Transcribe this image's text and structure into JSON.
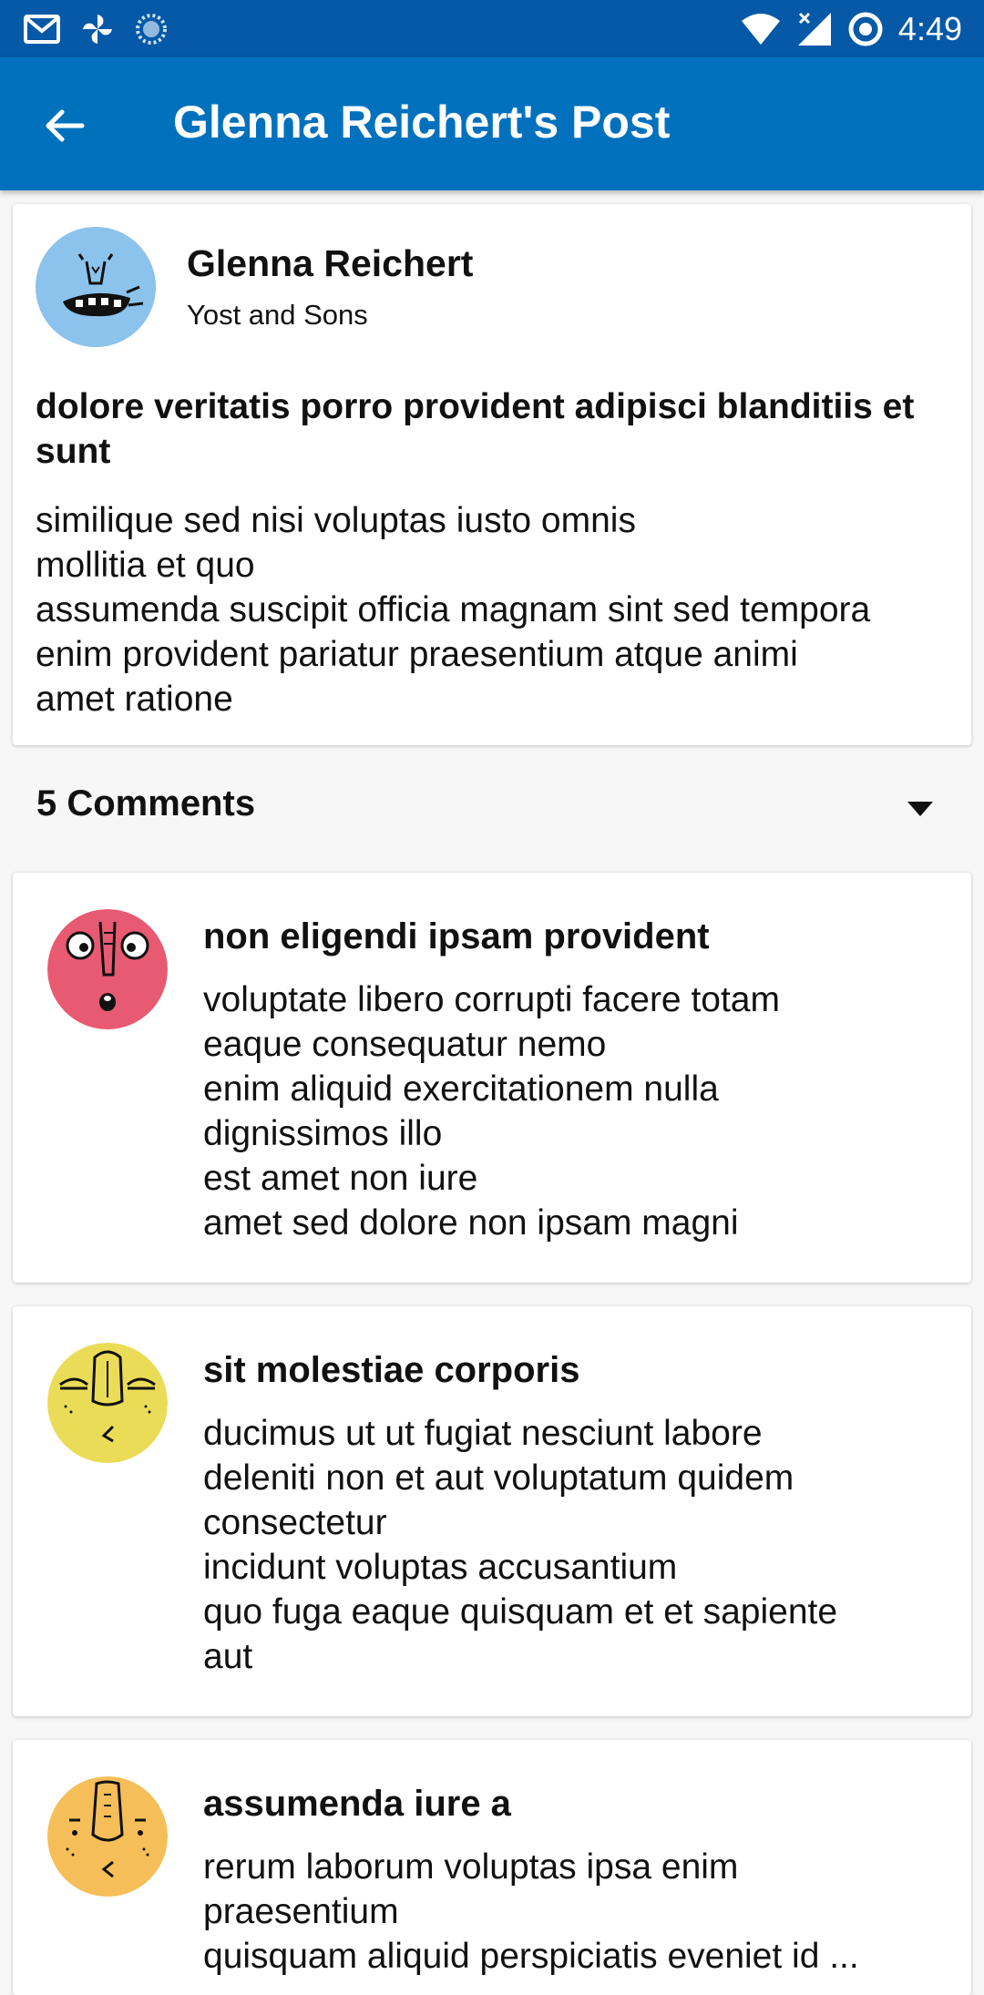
{
  "status_bar": {
    "time": "4:49",
    "left_icons": [
      "mail-icon",
      "pinwheel-icon",
      "sync-icon"
    ],
    "right_icons": [
      "wifi-icon",
      "cell-signal-icon",
      "data-saver-icon"
    ]
  },
  "app_bar": {
    "title": "Glenna Reichert's Post",
    "back_icon": "arrow-back-icon"
  },
  "post": {
    "author_name": "Glenna Reichert",
    "author_company": "Yost and Sons",
    "title": "dolore veritatis porro provident adipisci blanditiis et sunt",
    "body": "similique sed nisi voluptas iusto omnis\nmollitia et quo\nassumenda suscipit officia magnam sint sed tempora\nenim provident pariatur praesentium atque animi\namet ratione",
    "avatar_color": "#8cc3ec"
  },
  "comments": {
    "header": "5 Comments",
    "toggle_icon": "caret-down-icon",
    "items": [
      {
        "title": "non eligendi ipsam provident",
        "body": "voluptate libero corrupti facere totam\neaque consequatur nemo\nenim aliquid exercitationem nulla\ndignissimos illo\nest amet non iure\namet sed dolore non ipsam magni",
        "avatar_color": "#e85a72"
      },
      {
        "title": "sit molestiae corporis",
        "body": "ducimus ut ut fugiat nesciunt labore\ndeleniti non et aut voluptatum quidem\nconsectetur\nincidunt voluptas accusantium\nquo fuga eaque quisquam et et sapiente\naut",
        "avatar_color": "#ebdc58"
      },
      {
        "title": "assumenda iure a",
        "body": "rerum laborum voluptas ipsa enim\npraesentium\nquisquam aliquid perspiciatis eveniet id ...",
        "avatar_color": "#f5be58"
      }
    ]
  },
  "colors": {
    "status_bar": "#0559a6",
    "app_bar": "#0271bd",
    "background": "#f7f7f7"
  }
}
